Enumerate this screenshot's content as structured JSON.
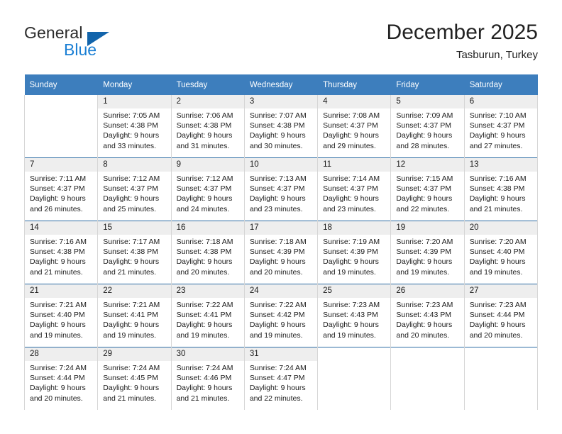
{
  "brand": {
    "name_part1": "General",
    "name_part2": "Blue",
    "triangle_color": "#1264ab",
    "blue_color": "#1a7fd4"
  },
  "header": {
    "title": "December 2025",
    "subtitle": "Tasburun, Turkey",
    "header_bg": "#3d7ebd",
    "row_divider": "#2e6da4",
    "daynum_band_bg": "#eeeeee"
  },
  "weekday_headers": [
    "Sunday",
    "Monday",
    "Tuesday",
    "Wednesday",
    "Thursday",
    "Friday",
    "Saturday"
  ],
  "weeks": [
    [
      {
        "day": "",
        "sunrise": "",
        "sunset": "",
        "daylight": "",
        "empty": true
      },
      {
        "day": "1",
        "sunrise": "Sunrise: 7:05 AM",
        "sunset": "Sunset: 4:38 PM",
        "daylight": "Daylight: 9 hours and 33 minutes."
      },
      {
        "day": "2",
        "sunrise": "Sunrise: 7:06 AM",
        "sunset": "Sunset: 4:38 PM",
        "daylight": "Daylight: 9 hours and 31 minutes."
      },
      {
        "day": "3",
        "sunrise": "Sunrise: 7:07 AM",
        "sunset": "Sunset: 4:38 PM",
        "daylight": "Daylight: 9 hours and 30 minutes."
      },
      {
        "day": "4",
        "sunrise": "Sunrise: 7:08 AM",
        "sunset": "Sunset: 4:37 PM",
        "daylight": "Daylight: 9 hours and 29 minutes."
      },
      {
        "day": "5",
        "sunrise": "Sunrise: 7:09 AM",
        "sunset": "Sunset: 4:37 PM",
        "daylight": "Daylight: 9 hours and 28 minutes."
      },
      {
        "day": "6",
        "sunrise": "Sunrise: 7:10 AM",
        "sunset": "Sunset: 4:37 PM",
        "daylight": "Daylight: 9 hours and 27 minutes."
      }
    ],
    [
      {
        "day": "7",
        "sunrise": "Sunrise: 7:11 AM",
        "sunset": "Sunset: 4:37 PM",
        "daylight": "Daylight: 9 hours and 26 minutes."
      },
      {
        "day": "8",
        "sunrise": "Sunrise: 7:12 AM",
        "sunset": "Sunset: 4:37 PM",
        "daylight": "Daylight: 9 hours and 25 minutes."
      },
      {
        "day": "9",
        "sunrise": "Sunrise: 7:12 AM",
        "sunset": "Sunset: 4:37 PM",
        "daylight": "Daylight: 9 hours and 24 minutes."
      },
      {
        "day": "10",
        "sunrise": "Sunrise: 7:13 AM",
        "sunset": "Sunset: 4:37 PM",
        "daylight": "Daylight: 9 hours and 23 minutes."
      },
      {
        "day": "11",
        "sunrise": "Sunrise: 7:14 AM",
        "sunset": "Sunset: 4:37 PM",
        "daylight": "Daylight: 9 hours and 23 minutes."
      },
      {
        "day": "12",
        "sunrise": "Sunrise: 7:15 AM",
        "sunset": "Sunset: 4:37 PM",
        "daylight": "Daylight: 9 hours and 22 minutes."
      },
      {
        "day": "13",
        "sunrise": "Sunrise: 7:16 AM",
        "sunset": "Sunset: 4:38 PM",
        "daylight": "Daylight: 9 hours and 21 minutes."
      }
    ],
    [
      {
        "day": "14",
        "sunrise": "Sunrise: 7:16 AM",
        "sunset": "Sunset: 4:38 PM",
        "daylight": "Daylight: 9 hours and 21 minutes."
      },
      {
        "day": "15",
        "sunrise": "Sunrise: 7:17 AM",
        "sunset": "Sunset: 4:38 PM",
        "daylight": "Daylight: 9 hours and 21 minutes."
      },
      {
        "day": "16",
        "sunrise": "Sunrise: 7:18 AM",
        "sunset": "Sunset: 4:38 PM",
        "daylight": "Daylight: 9 hours and 20 minutes."
      },
      {
        "day": "17",
        "sunrise": "Sunrise: 7:18 AM",
        "sunset": "Sunset: 4:39 PM",
        "daylight": "Daylight: 9 hours and 20 minutes."
      },
      {
        "day": "18",
        "sunrise": "Sunrise: 7:19 AM",
        "sunset": "Sunset: 4:39 PM",
        "daylight": "Daylight: 9 hours and 19 minutes."
      },
      {
        "day": "19",
        "sunrise": "Sunrise: 7:20 AM",
        "sunset": "Sunset: 4:39 PM",
        "daylight": "Daylight: 9 hours and 19 minutes."
      },
      {
        "day": "20",
        "sunrise": "Sunrise: 7:20 AM",
        "sunset": "Sunset: 4:40 PM",
        "daylight": "Daylight: 9 hours and 19 minutes."
      }
    ],
    [
      {
        "day": "21",
        "sunrise": "Sunrise: 7:21 AM",
        "sunset": "Sunset: 4:40 PM",
        "daylight": "Daylight: 9 hours and 19 minutes."
      },
      {
        "day": "22",
        "sunrise": "Sunrise: 7:21 AM",
        "sunset": "Sunset: 4:41 PM",
        "daylight": "Daylight: 9 hours and 19 minutes."
      },
      {
        "day": "23",
        "sunrise": "Sunrise: 7:22 AM",
        "sunset": "Sunset: 4:41 PM",
        "daylight": "Daylight: 9 hours and 19 minutes."
      },
      {
        "day": "24",
        "sunrise": "Sunrise: 7:22 AM",
        "sunset": "Sunset: 4:42 PM",
        "daylight": "Daylight: 9 hours and 19 minutes."
      },
      {
        "day": "25",
        "sunrise": "Sunrise: 7:23 AM",
        "sunset": "Sunset: 4:43 PM",
        "daylight": "Daylight: 9 hours and 19 minutes."
      },
      {
        "day": "26",
        "sunrise": "Sunrise: 7:23 AM",
        "sunset": "Sunset: 4:43 PM",
        "daylight": "Daylight: 9 hours and 20 minutes."
      },
      {
        "day": "27",
        "sunrise": "Sunrise: 7:23 AM",
        "sunset": "Sunset: 4:44 PM",
        "daylight": "Daylight: 9 hours and 20 minutes."
      }
    ],
    [
      {
        "day": "28",
        "sunrise": "Sunrise: 7:24 AM",
        "sunset": "Sunset: 4:44 PM",
        "daylight": "Daylight: 9 hours and 20 minutes."
      },
      {
        "day": "29",
        "sunrise": "Sunrise: 7:24 AM",
        "sunset": "Sunset: 4:45 PM",
        "daylight": "Daylight: 9 hours and 21 minutes."
      },
      {
        "day": "30",
        "sunrise": "Sunrise: 7:24 AM",
        "sunset": "Sunset: 4:46 PM",
        "daylight": "Daylight: 9 hours and 21 minutes."
      },
      {
        "day": "31",
        "sunrise": "Sunrise: 7:24 AM",
        "sunset": "Sunset: 4:47 PM",
        "daylight": "Daylight: 9 hours and 22 minutes."
      },
      {
        "day": "",
        "sunrise": "",
        "sunset": "",
        "daylight": "",
        "empty": true
      },
      {
        "day": "",
        "sunrise": "",
        "sunset": "",
        "daylight": "",
        "empty": true
      },
      {
        "day": "",
        "sunrise": "",
        "sunset": "",
        "daylight": "",
        "empty": true
      }
    ]
  ]
}
